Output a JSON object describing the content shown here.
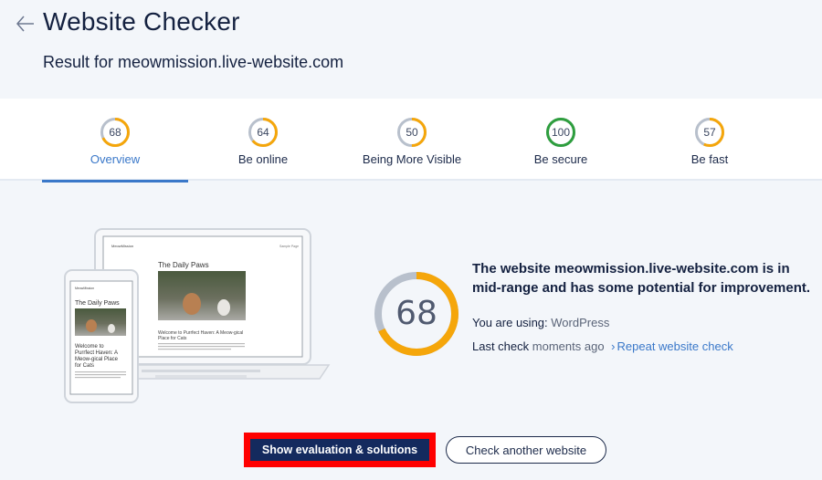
{
  "header": {
    "back_icon": "arrow-left-icon",
    "title": "Website Checker",
    "subtitle": "Result for meowmission.live-website.com"
  },
  "tabs": [
    {
      "label": "Overview",
      "score": "68",
      "score_fraction": 0.68,
      "color": "#f5a60a",
      "active": true
    },
    {
      "label": "Be online",
      "score": "64",
      "score_fraction": 0.64,
      "color": "#f5a60a",
      "active": false
    },
    {
      "label": "Being More Visible",
      "score": "50",
      "score_fraction": 0.5,
      "color": "#f5a60a",
      "active": false
    },
    {
      "label": "Be secure",
      "score": "100",
      "score_fraction": 1.0,
      "color": "#2e9e3e",
      "active": false
    },
    {
      "label": "Be fast",
      "score": "57",
      "score_fraction": 0.57,
      "color": "#f5a60a",
      "active": false
    }
  ],
  "illustration": {
    "laptop_site_name": "MeowMission",
    "laptop_nav": "Sample Page",
    "laptop_heading": "The Daily Paws",
    "laptop_post_title_1": "Welcome to Purrfect Haven: A Meow-gical",
    "laptop_post_title_2": "Place for Cats",
    "phone_site_name": "MeowMission",
    "phone_heading": "The Daily Paws",
    "phone_post_title": [
      "Welcome to",
      "Purrfect Haven: A",
      "Meow-gical Place",
      "for Cats"
    ]
  },
  "result": {
    "score": "68",
    "score_fraction": 0.68,
    "score_color": "#f5a60a",
    "track_color": "#b8c0cc",
    "summary": "The website meowmission.live-website.com is in mid-range and has some potential for improvement.",
    "platform_label": "You are using:",
    "platform_value": "WordPress",
    "last_check_label": "Last check",
    "last_check_value": "moments ago",
    "repeat_chevron": "›",
    "repeat_link": "Repeat website check"
  },
  "actions": {
    "primary": "Show evaluation & solutions",
    "secondary": "Check another website"
  },
  "colors": {
    "accent": "#3a78c9",
    "primary_button": "#142a5e",
    "highlight": "#ff0000",
    "good": "#2e9e3e",
    "warning": "#f5a60a"
  }
}
